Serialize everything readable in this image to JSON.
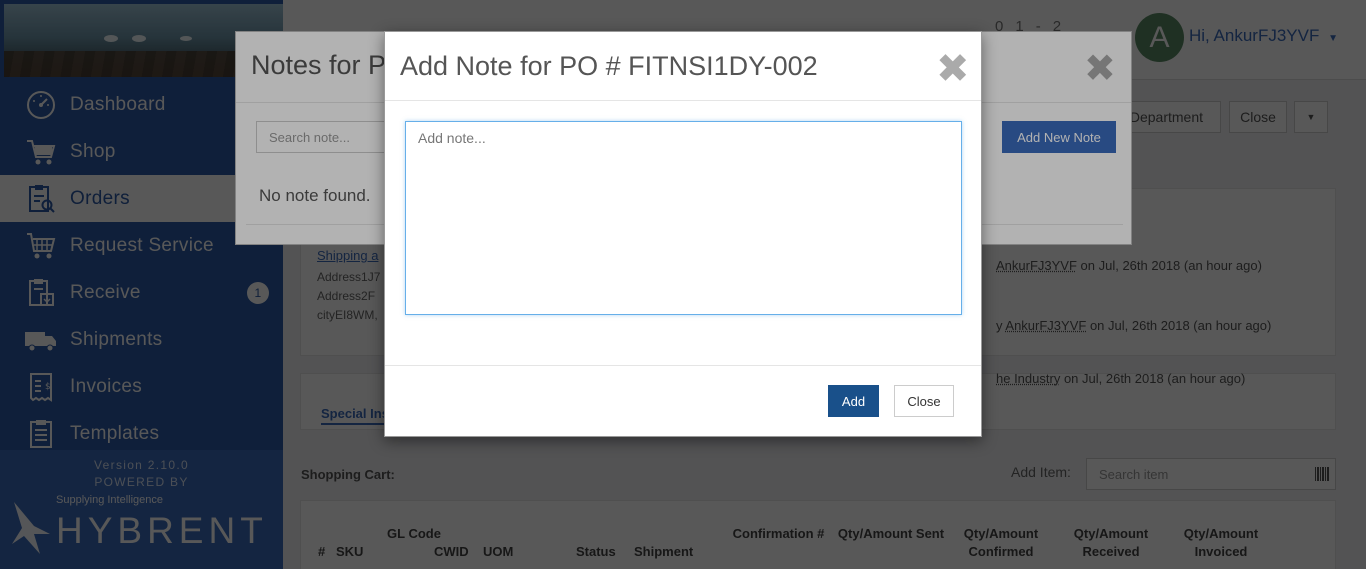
{
  "sidebar": {
    "items": [
      {
        "label": "Dashboard",
        "icon": "dashboard-icon"
      },
      {
        "label": "Shop",
        "icon": "cart-icon"
      },
      {
        "label": "Orders",
        "icon": "orders-icon",
        "active": true
      },
      {
        "label": "Request Service",
        "icon": "request-service-icon"
      },
      {
        "label": "Receive",
        "icon": "receive-icon",
        "badge": "1"
      },
      {
        "label": "Shipments",
        "icon": "truck-icon"
      },
      {
        "label": "Invoices",
        "icon": "invoice-icon"
      },
      {
        "label": "Templates",
        "icon": "templates-icon"
      }
    ],
    "version": "Version 2.10.0",
    "powered_by": "POWERED BY",
    "logo_word": "HYBRENT",
    "logo_tagline": "Supplying Intelligence"
  },
  "topbar": {
    "stat_1": "0",
    "stat_2": "1",
    "stat_3": "-",
    "stat_4": "2",
    "avatar_letter": "A",
    "greeting": "Hi, AnkurFJ3YVF"
  },
  "main": {
    "dept_button": "/Department",
    "close_button": "Close",
    "shipping_label": "Shipping a",
    "address_lines": [
      "Address1J7",
      "Address2F",
      "cityEI8WM,"
    ],
    "activities": [
      {
        "user": "AnkurFJ3YVF",
        "text": " on Jul, 26th 2018 (an hour ago)"
      },
      {
        "prefix": "y ",
        "user": "AnkurFJ3YVF",
        "text": " on Jul, 26th 2018 (an hour ago)"
      },
      {
        "user": "he Industry",
        "text": " on Jul, 26th 2018 (an hour ago)"
      }
    ],
    "special_tab": "Special Ins",
    "cart_title": "Shopping Cart:",
    "add_item_label": "Add Item:",
    "search_item_placeholder": "Search item",
    "table_headers": [
      "#",
      "SKU",
      "GL Code",
      "CWID",
      "UOM",
      "Status",
      "Shipment",
      "Confirmation #",
      "Qty/Amount Sent",
      "Qty/Amount Confirmed",
      "Qty/Amount Received",
      "Qty/Amount Invoiced"
    ]
  },
  "notes_modal": {
    "title": "Notes for P",
    "search_placeholder": "Search note...",
    "add_new_button": "Add New Note",
    "empty_text": "No note found."
  },
  "add_note_modal": {
    "title": "Add Note for PO # FITNSI1DY-002",
    "textarea_value": "",
    "textarea_placeholder": "Add note...",
    "add_button": "Add",
    "close_button": "Close"
  },
  "colors": {
    "sidebar": "#2d5aa6",
    "primary_button": "#19508a",
    "accent": "#3a6abb"
  }
}
